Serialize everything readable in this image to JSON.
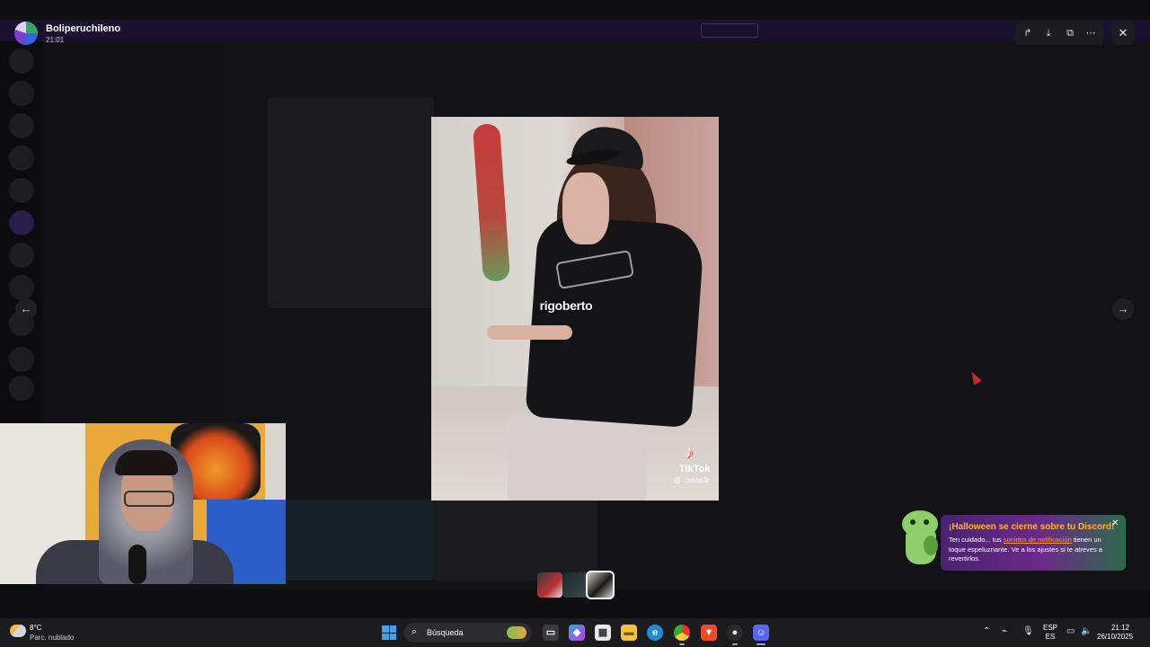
{
  "viewer": {
    "author": "Boliperuchileno",
    "timestamp": "21:01",
    "toolbar_icons": [
      "forward-icon",
      "download-icon",
      "open-external-icon",
      "more-icon"
    ],
    "close_icon": "close-icon"
  },
  "media": {
    "caption": "rigoberto",
    "watermark_brand": "TikTok",
    "watermark_handle": "@ .maaa3r"
  },
  "thumbnails": {
    "count": 3,
    "selected_index": 2
  },
  "toast": {
    "title": "¡Halloween se cierne sobre tu Discord!",
    "body_before": "Ten cuidado... tus ",
    "link": "sonidos de notificación",
    "body_after": " tienen un toque espeluznante. Ve a los ajustes si te atreves a revertirlos."
  },
  "taskbar": {
    "temperature": "8°C",
    "weather": "Parc. nublado",
    "search_placeholder": "Búsqueda",
    "language_line1": "ESP",
    "language_line2": "ES",
    "time": "21:12",
    "date": "26/10/2025"
  },
  "colors": {
    "accent_purple": "#5865f2",
    "toast_title": "#ffb13c",
    "toast_link": "#ff9d2e"
  }
}
